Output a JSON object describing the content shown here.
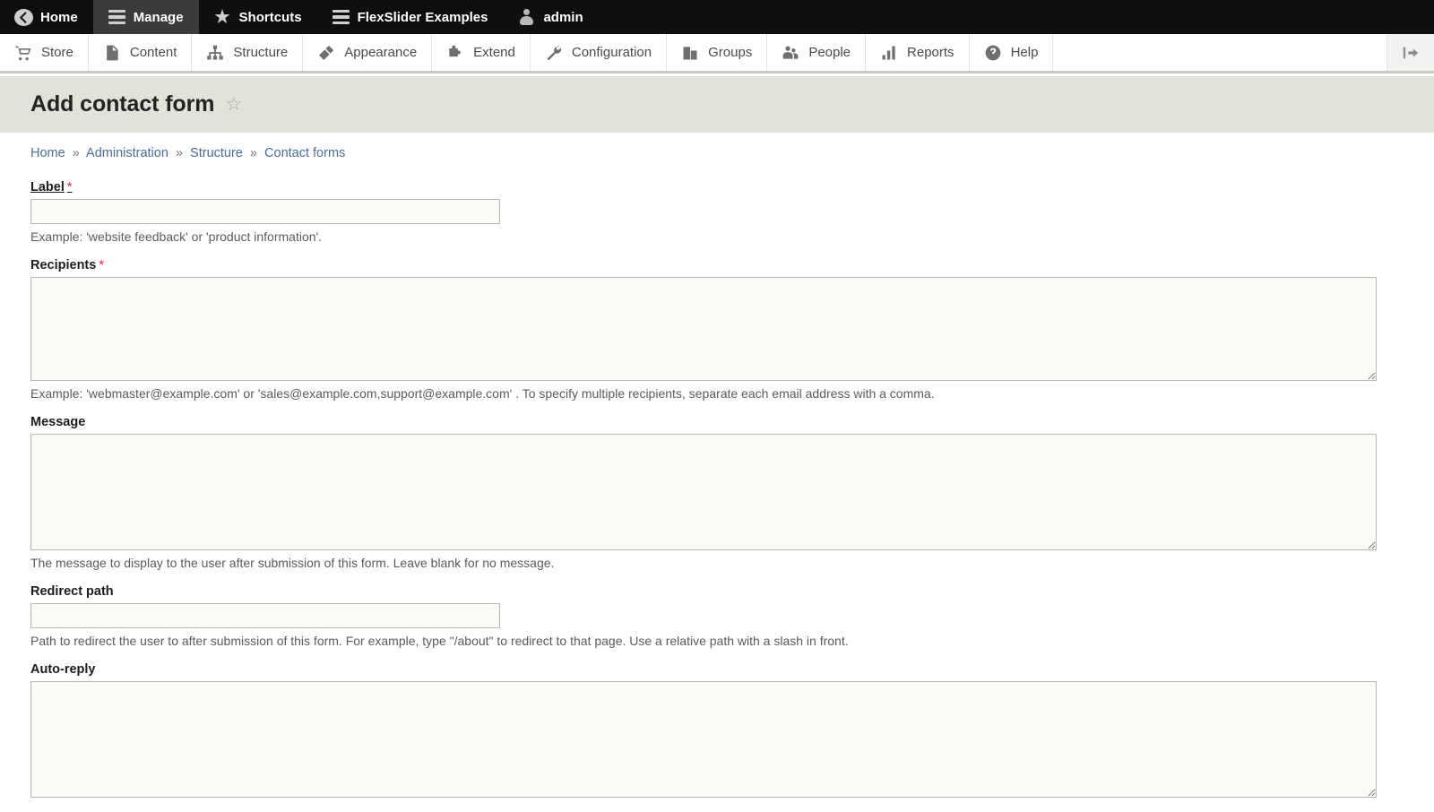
{
  "toolbar_bar": {
    "tabs": [
      {
        "label": "Home",
        "icon": "back-arrow-icon",
        "active": false
      },
      {
        "label": "Manage",
        "icon": "hamburger-icon",
        "active": true
      },
      {
        "label": "Shortcuts",
        "icon": "star-icon",
        "active": false
      },
      {
        "label": "FlexSlider Examples",
        "icon": "hamburger-icon",
        "active": false
      },
      {
        "label": "admin",
        "icon": "person-icon",
        "active": false
      }
    ]
  },
  "toolbar_tray": {
    "items": [
      {
        "label": "Store",
        "icon": "shopping-cart-icon"
      },
      {
        "label": "Content",
        "icon": "document-icon"
      },
      {
        "label": "Structure",
        "icon": "sitemap-icon"
      },
      {
        "label": "Appearance",
        "icon": "paintbrush-icon"
      },
      {
        "label": "Extend",
        "icon": "puzzle-piece-icon"
      },
      {
        "label": "Configuration",
        "icon": "wrench-icon"
      },
      {
        "label": "Groups",
        "icon": "groups-icon"
      },
      {
        "label": "People",
        "icon": "people-icon"
      },
      {
        "label": "Reports",
        "icon": "bar-chart-icon"
      },
      {
        "label": "Help",
        "icon": "question-circle-icon"
      }
    ],
    "toggle_icon": "collapse-toolbar-icon"
  },
  "page": {
    "title": "Add contact form",
    "favorite_icon": "star-outline-icon"
  },
  "breadcrumb": {
    "separator": "»",
    "items": [
      "Home",
      "Administration",
      "Structure",
      "Contact forms"
    ]
  },
  "form": {
    "fields": [
      {
        "key": "label",
        "label": "Label",
        "required": true,
        "value": "",
        "description": "Example: 'website feedback' or 'product information'."
      },
      {
        "key": "recipients",
        "label": "Recipients",
        "required": true,
        "value": "",
        "description": "Example: 'webmaster@example.com' or 'sales@example.com,support@example.com' . To specify multiple recipients, separate each email address with a comma."
      },
      {
        "key": "message",
        "label": "Message",
        "required": false,
        "value": "",
        "description": "The message to display to the user after submission of this form. Leave blank for no message."
      },
      {
        "key": "redirect_path",
        "label": "Redirect path",
        "required": false,
        "value": "",
        "description": "Path to redirect the user to after submission of this form. For example, type \"/about\" to redirect to that page. Use a relative path with a slash in front."
      },
      {
        "key": "auto_reply",
        "label": "Auto-reply",
        "required": false,
        "value": "",
        "description": ""
      }
    ]
  },
  "colors": {
    "bar_background": "#0f0f0f",
    "bar_active": "#3b3b3b",
    "title_band": "#e2e2da",
    "link": "#4c6c9b",
    "required_marker": "#e02443",
    "field_border": "#b8b8b0",
    "field_background": "#fafaf7"
  }
}
